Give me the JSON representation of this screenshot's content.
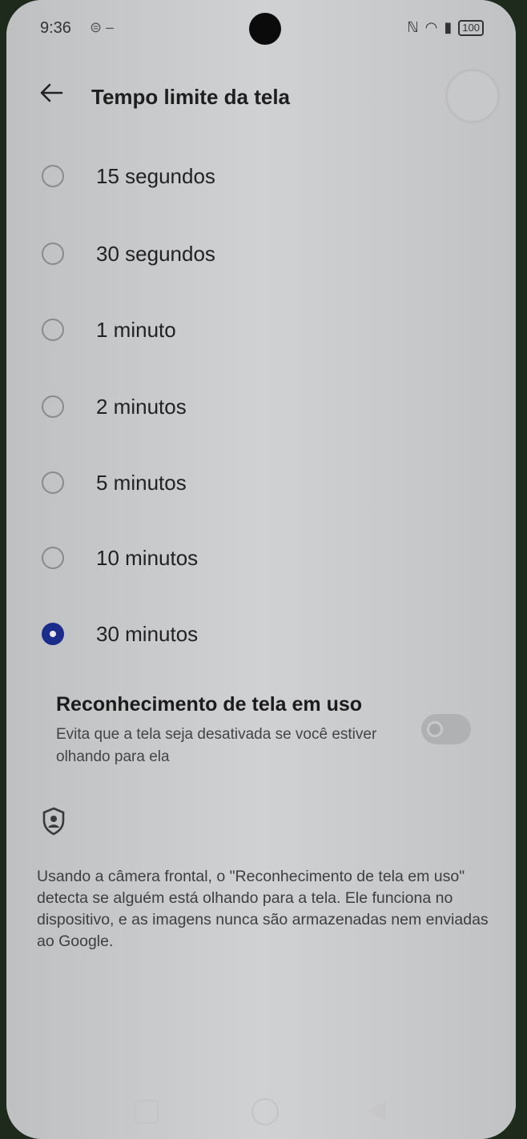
{
  "status_bar": {
    "time": "9:36",
    "battery": "100"
  },
  "header": {
    "title": "Tempo limite da tela"
  },
  "options": [
    {
      "label": "15 segundos",
      "selected": false
    },
    {
      "label": "30 segundos",
      "selected": false
    },
    {
      "label": "1 minuto",
      "selected": false
    },
    {
      "label": "2 minutos",
      "selected": false
    },
    {
      "label": "5 minutos",
      "selected": false
    },
    {
      "label": "10 minutos",
      "selected": false
    },
    {
      "label": "30 minutos",
      "selected": true
    }
  ],
  "screen_attention": {
    "title": "Reconhecimento de tela em uso",
    "description": "Evita que a tela seja desativada se você estiver olhando para ela",
    "enabled": false
  },
  "info": {
    "text": "Usando a câmera frontal, o \"Reconhecimento de tela em uso\" detecta se alguém está olhando para a tela. Ele funciona no dispositivo, e as imagens nunca são armazenadas nem enviadas ao Google."
  },
  "colors": {
    "accent": "#1b2d8a",
    "background": "#c9c9cb"
  }
}
